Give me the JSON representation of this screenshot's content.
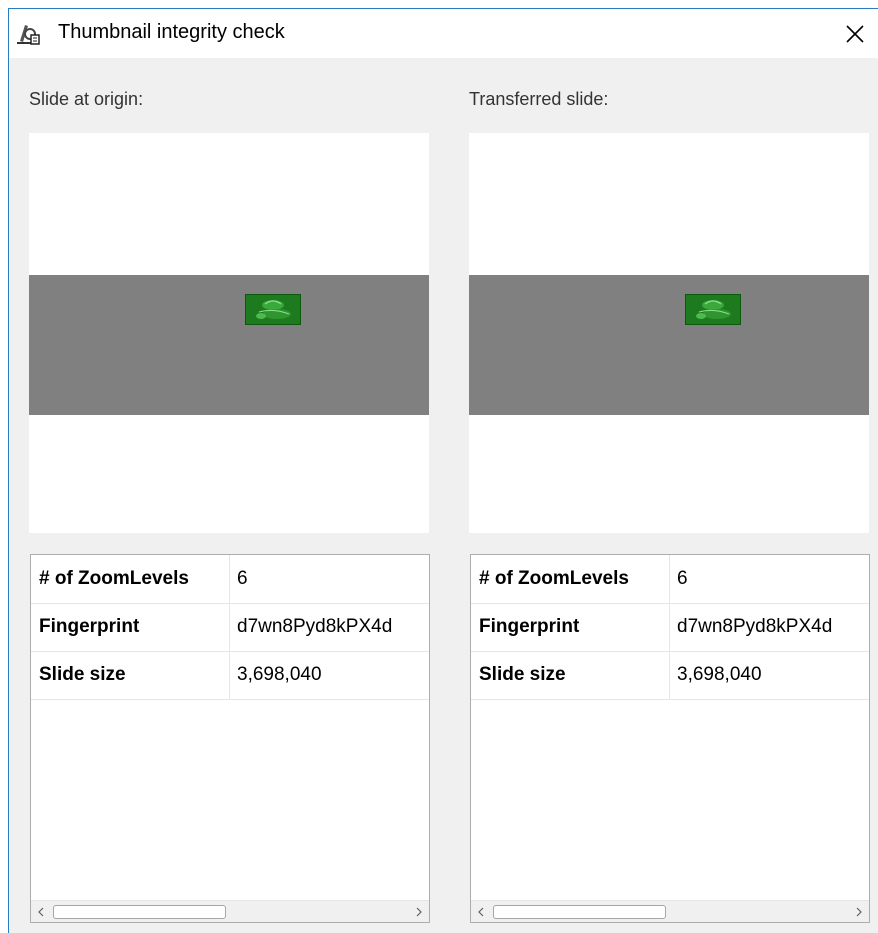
{
  "window": {
    "title": "Thumbnail integrity check",
    "icon": "microscope-icon",
    "close_icon": "close-icon"
  },
  "colors": {
    "window_border": "#2b7bc1",
    "background": "#f0f0f0",
    "thumbnail_band": "#808080",
    "tile_green": "#1e7a1e"
  },
  "panels": [
    {
      "label": "Slide at origin:",
      "properties": [
        {
          "key": "# of ZoomLevels",
          "value": "6"
        },
        {
          "key": "Fingerprint",
          "value": "d7wn8Pyd8kPX4d"
        },
        {
          "key": "Slide size",
          "value": "3,698,040"
        }
      ]
    },
    {
      "label": "Transferred slide:",
      "properties": [
        {
          "key": "# of ZoomLevels",
          "value": "6"
        },
        {
          "key": "Fingerprint",
          "value": "d7wn8Pyd8kPX4d"
        },
        {
          "key": "Slide size",
          "value": "3,698,040"
        }
      ]
    }
  ]
}
